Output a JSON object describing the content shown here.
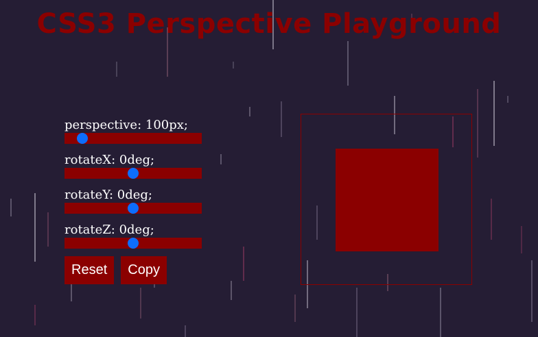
{
  "app": {
    "title": "CSS3 Perspective Playground"
  },
  "controls": [
    {
      "label": "perspective: 100px;",
      "property": "perspective",
      "value": 100,
      "unit": "px",
      "level": 0.13
    },
    {
      "label": "rotateX: 0deg;",
      "property": "rotateX",
      "value": 0,
      "unit": "deg",
      "level": 0.5
    },
    {
      "label": "rotateY: 0deg;",
      "property": "rotateY",
      "value": 0,
      "unit": "deg",
      "level": 0.5
    },
    {
      "label": "rotateZ: 0deg;",
      "property": "rotateZ",
      "value": 0,
      "unit": "deg",
      "level": 0.5
    }
  ],
  "buttons": {
    "reset_label": "Reset",
    "copy_label": "Copy"
  },
  "colors": {
    "background": "#251d34",
    "accent": "#8b0000",
    "thumb": "#0d6efd",
    "text": "#ffffff"
  },
  "icons": {
    "slider_thumb": "slider-thumb-icon"
  }
}
